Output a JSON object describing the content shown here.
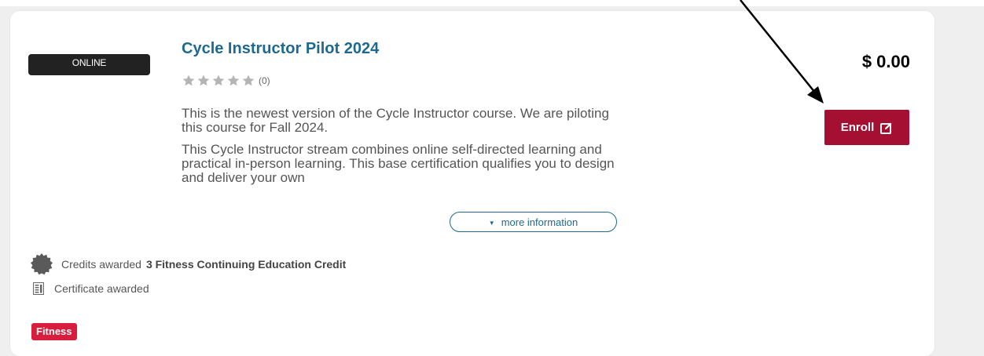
{
  "course": {
    "format_badge": "ONLINE",
    "title": "Cycle Instructor Pilot 2024",
    "rating": {
      "stars": 0,
      "max_stars": 5,
      "count_label": "(0)"
    },
    "description": [
      "This is the newest version of the Cycle Instructor course. We are piloting this course for Fall 2024.",
      "This Cycle Instructor stream combines online self-directed learning and practical in-person learning. This base certification qualifies you to design and deliver your own"
    ],
    "more_info_label": "more information",
    "price": "$ 0.00",
    "enroll_label": "Enroll",
    "credits_label": "Credits awarded",
    "credits_value": "3 Fitness Continuing Education Credit",
    "certificate_label": "Certificate awarded",
    "tag": "Fitness"
  },
  "icons": {
    "star": "star-icon",
    "enroll": "edit-icon",
    "caret": "caret-down-icon",
    "credits": "seal-icon",
    "certificate": "certificate-icon"
  },
  "colors": {
    "title": "#1e6a8e",
    "enroll_button": "#a50f32",
    "tag": "#d81e3c",
    "badge": "#222222",
    "star_empty": "#b5b5b5"
  }
}
